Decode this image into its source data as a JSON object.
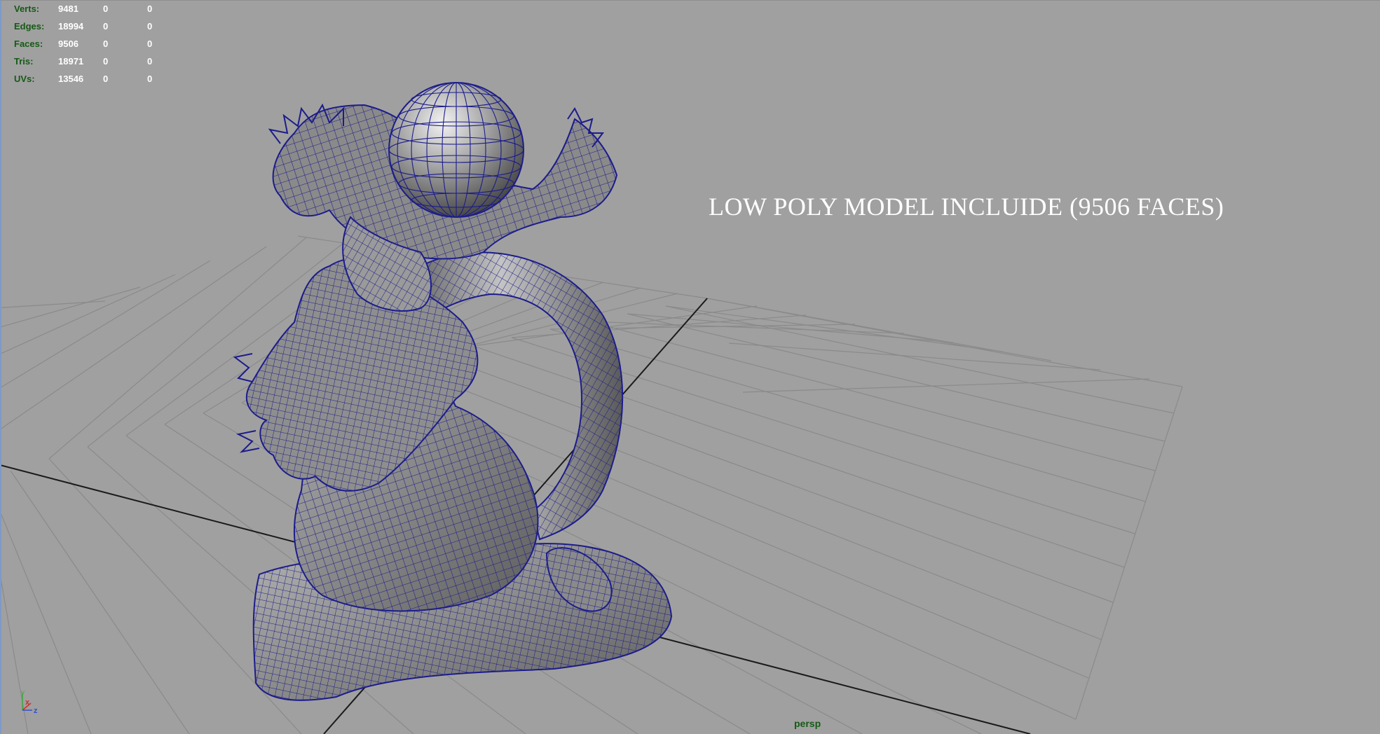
{
  "hud": {
    "rows": [
      {
        "label": "Verts:",
        "total": "9481",
        "selected": "0",
        "other": "0"
      },
      {
        "label": "Edges:",
        "total": "18994",
        "selected": "0",
        "other": "0"
      },
      {
        "label": "Faces:",
        "total": "9506",
        "selected": "0",
        "other": "0"
      },
      {
        "label": "Tris:",
        "total": "18971",
        "selected": "0",
        "other": "0"
      },
      {
        "label": "UVs:",
        "total": "13546",
        "selected": "0",
        "other": "0"
      }
    ]
  },
  "overlay": {
    "caption": "LOW POLY MODEL INCLUIDE (9506 FACES)"
  },
  "viewport": {
    "camera": "persp"
  },
  "axis": {
    "x": "x",
    "y": "y",
    "z": "z"
  },
  "colors": {
    "background": "#a0a0a0",
    "grid": "#8a8a8a",
    "grid_axis": "#1a1a1a",
    "wireframe": "#1c1c8c",
    "mesh_fill": "#8c8c8c",
    "hud_label": "#155a15",
    "hud_value": "#ffffff"
  }
}
